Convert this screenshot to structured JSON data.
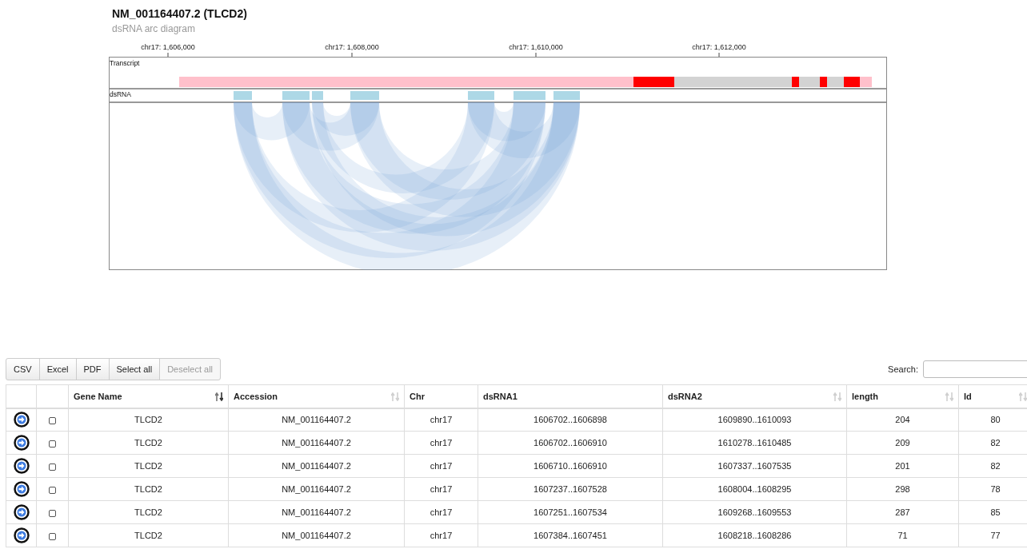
{
  "title": "NM_001164407.2 (TLCD2)",
  "subtitle": "dsRNA arc diagram",
  "diagram": {
    "ticks": [
      "chr17: 1,606,000",
      "chr17: 1,608,000",
      "chr17: 1,610,000",
      "chr17: 1,612,000"
    ],
    "tracks": [
      "Transcript",
      "dsRNA"
    ]
  },
  "toolbar": {
    "buttons": [
      {
        "label": "CSV",
        "disabled": false
      },
      {
        "label": "Excel",
        "disabled": false
      },
      {
        "label": "PDF",
        "disabled": false
      },
      {
        "label": "Select all",
        "disabled": false
      },
      {
        "label": "Deselect all",
        "disabled": true
      }
    ]
  },
  "search": {
    "label": "Search:"
  },
  "table": {
    "columns": [
      {
        "label": "Gene Name",
        "sortable": true,
        "selected": true
      },
      {
        "label": "Accession",
        "sortable": true,
        "selected": false
      },
      {
        "label": "Chr",
        "sortable": false,
        "selected": false
      },
      {
        "label": "dsRNA1",
        "sortable": false,
        "selected": false
      },
      {
        "label": "dsRNA2",
        "sortable": true,
        "selected": false
      },
      {
        "label": "length",
        "sortable": true,
        "selected": false
      },
      {
        "label": "Id",
        "sortable": true,
        "selected": false
      }
    ],
    "rows": [
      {
        "checked": false,
        "cells": [
          "TLCD2",
          "NM_001164407.2",
          "chr17",
          "1606702..1606898",
          "1609890..1610093",
          "204",
          "80"
        ]
      },
      {
        "checked": false,
        "cells": [
          "TLCD2",
          "NM_001164407.2",
          "chr17",
          "1606702..1606910",
          "1610278..1610485",
          "209",
          "82"
        ]
      },
      {
        "checked": false,
        "cells": [
          "TLCD2",
          "NM_001164407.2",
          "chr17",
          "1606710..1606910",
          "1607337..1607535",
          "201",
          "82"
        ]
      },
      {
        "checked": false,
        "cells": [
          "TLCD2",
          "NM_001164407.2",
          "chr17",
          "1607237..1607528",
          "1608004..1608295",
          "298",
          "78"
        ]
      },
      {
        "checked": false,
        "cells": [
          "TLCD2",
          "NM_001164407.2",
          "chr17",
          "1607251..1607534",
          "1609268..1609553",
          "287",
          "85"
        ]
      },
      {
        "checked": false,
        "cells": [
          "TLCD2",
          "NM_001164407.2",
          "chr17",
          "1607384..1607451",
          "1608218..1608286",
          "71",
          "77"
        ]
      }
    ]
  }
}
